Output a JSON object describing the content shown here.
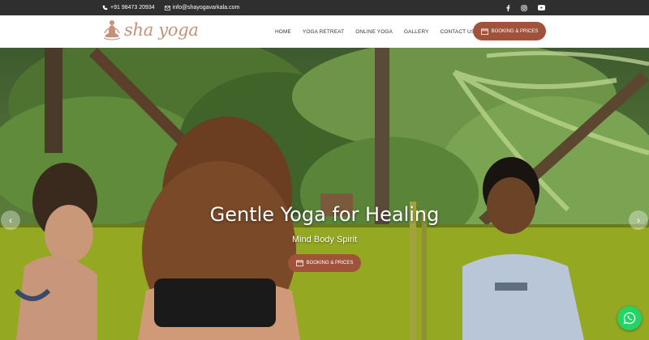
{
  "topbar": {
    "phone": "+91 98473 20934",
    "email": "info@shayogavarkala.com",
    "social_icons": [
      "facebook-icon",
      "instagram-icon",
      "youtube-icon"
    ]
  },
  "header": {
    "logo_text": "sha yoga",
    "nav": [
      "HOME",
      "YOGA RETREAT",
      "ONLINE YOGA",
      "GALLERY",
      "CONTACT US"
    ],
    "booking_label": "BOOKING & PRICES"
  },
  "hero": {
    "title": "Gentle Yoga for Healing",
    "subtitle": "Mind Body Spirit",
    "button_label": "BOOKING & PRICES",
    "prev_arrow": "‹",
    "next_arrow": "›"
  },
  "colors": {
    "brand": "#a0533a",
    "logo": "#c49276",
    "topbar": "#2f2f2f",
    "whatsapp": "#25d366"
  }
}
